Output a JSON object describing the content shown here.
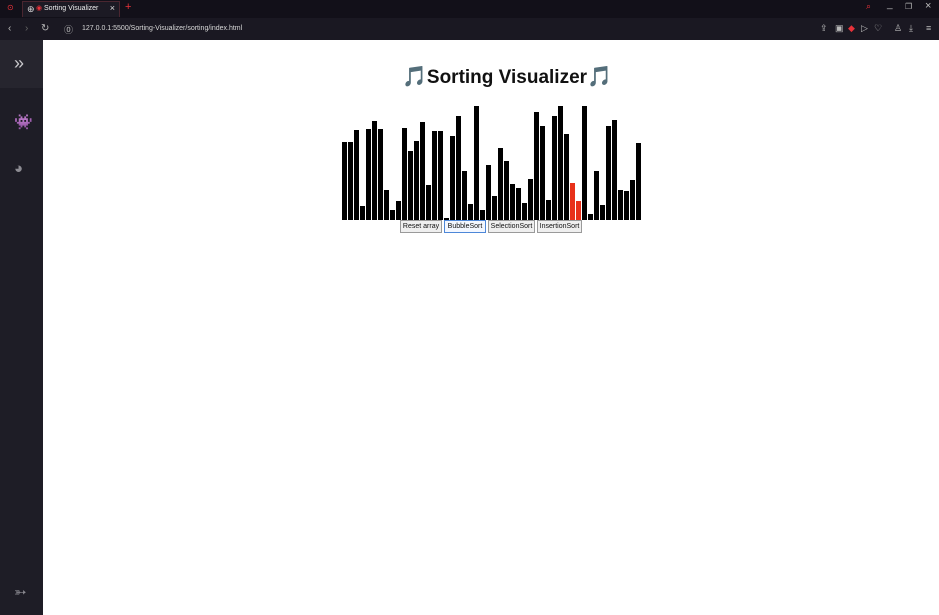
{
  "browser": {
    "tab_title": "Sorting Visualizer",
    "url": "127.0.0.1:5500/Sorting-Visualizer/sorting/index.html"
  },
  "page": {
    "title": "Sorting Visualizer",
    "note_glyph": "🎵",
    "buttons": [
      "Reset array",
      "BubbleSort",
      "SelectionSort",
      "InsertionSort"
    ],
    "colors": {
      "bar": "#000000",
      "highlight": "#e8311a",
      "accent": "#e8323a"
    },
    "bars": [
      78,
      78,
      90,
      14,
      91,
      99,
      91,
      30,
      10,
      19,
      92,
      69,
      79,
      98,
      35,
      89,
      89,
      0,
      84,
      104,
      49,
      16,
      114,
      10,
      55,
      24,
      72,
      59,
      36,
      32,
      17,
      41,
      108,
      94,
      20,
      104,
      114,
      86,
      37,
      19,
      114,
      6,
      49,
      15,
      94,
      100,
      30,
      29,
      40,
      77
    ],
    "highlight_bars": [
      38,
      39
    ]
  }
}
